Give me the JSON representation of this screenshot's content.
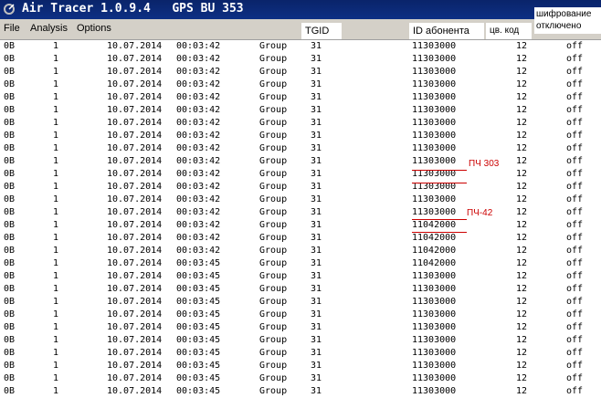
{
  "window": {
    "title": "Air Tracer 1.0.9.4   GPS BU 353"
  },
  "menu": [
    {
      "label": "File"
    },
    {
      "label": "Analysis"
    },
    {
      "label": "Options"
    }
  ],
  "headers": {
    "tgid": "TGID",
    "subscriber_id": "ID абонента",
    "color_code": "цв. код",
    "encryption_line1": "шифрование",
    "encryption_line2": "отключено"
  },
  "rows": [
    {
      "c1": "0B",
      "c2": "1",
      "date": "10.07.2014",
      "time": "00:03:42",
      "type": "Group",
      "tgid": "31",
      "subscriber": "11303000",
      "code": "12",
      "enc": "off"
    },
    {
      "c1": "0B",
      "c2": "1",
      "date": "10.07.2014",
      "time": "00:03:42",
      "type": "Group",
      "tgid": "31",
      "subscriber": "11303000",
      "code": "12",
      "enc": "off"
    },
    {
      "c1": "0B",
      "c2": "1",
      "date": "10.07.2014",
      "time": "00:03:42",
      "type": "Group",
      "tgid": "31",
      "subscriber": "11303000",
      "code": "12",
      "enc": "off"
    },
    {
      "c1": "0B",
      "c2": "1",
      "date": "10.07.2014",
      "time": "00:03:42",
      "type": "Group",
      "tgid": "31",
      "subscriber": "11303000",
      "code": "12",
      "enc": "off"
    },
    {
      "c1": "0B",
      "c2": "1",
      "date": "10.07.2014",
      "time": "00:03:42",
      "type": "Group",
      "tgid": "31",
      "subscriber": "11303000",
      "code": "12",
      "enc": "off"
    },
    {
      "c1": "0B",
      "c2": "1",
      "date": "10.07.2014",
      "time": "00:03:42",
      "type": "Group",
      "tgid": "31",
      "subscriber": "11303000",
      "code": "12",
      "enc": "off"
    },
    {
      "c1": "0B",
      "c2": "1",
      "date": "10.07.2014",
      "time": "00:03:42",
      "type": "Group",
      "tgid": "31",
      "subscriber": "11303000",
      "code": "12",
      "enc": "off"
    },
    {
      "c1": "0B",
      "c2": "1",
      "date": "10.07.2014",
      "time": "00:03:42",
      "type": "Group",
      "tgid": "31",
      "subscriber": "11303000",
      "code": "12",
      "enc": "off"
    },
    {
      "c1": "0B",
      "c2": "1",
      "date": "10.07.2014",
      "time": "00:03:42",
      "type": "Group",
      "tgid": "31",
      "subscriber": "11303000",
      "code": "12",
      "enc": "off"
    },
    {
      "c1": "0B",
      "c2": "1",
      "date": "10.07.2014",
      "time": "00:03:42",
      "type": "Group",
      "tgid": "31",
      "subscriber": "11303000",
      "code": "12",
      "enc": "off"
    },
    {
      "c1": "0B",
      "c2": "1",
      "date": "10.07.2014",
      "time": "00:03:42",
      "type": "Group",
      "tgid": "31",
      "subscriber": "11303000",
      "code": "12",
      "enc": "off"
    },
    {
      "c1": "0B",
      "c2": "1",
      "date": "10.07.2014",
      "time": "00:03:42",
      "type": "Group",
      "tgid": "31",
      "subscriber": "11303000",
      "code": "12",
      "enc": "off"
    },
    {
      "c1": "0B",
      "c2": "1",
      "date": "10.07.2014",
      "time": "00:03:42",
      "type": "Group",
      "tgid": "31",
      "subscriber": "11303000",
      "code": "12",
      "enc": "off"
    },
    {
      "c1": "0B",
      "c2": "1",
      "date": "10.07.2014",
      "time": "00:03:42",
      "type": "Group",
      "tgid": "31",
      "subscriber": "11303000",
      "code": "12",
      "enc": "off"
    },
    {
      "c1": "0B",
      "c2": "1",
      "date": "10.07.2014",
      "time": "00:03:42",
      "type": "Group",
      "tgid": "31",
      "subscriber": "11042000",
      "code": "12",
      "enc": "off"
    },
    {
      "c1": "0B",
      "c2": "1",
      "date": "10.07.2014",
      "time": "00:03:42",
      "type": "Group",
      "tgid": "31",
      "subscriber": "11042000",
      "code": "12",
      "enc": "off"
    },
    {
      "c1": "0B",
      "c2": "1",
      "date": "10.07.2014",
      "time": "00:03:42",
      "type": "Group",
      "tgid": "31",
      "subscriber": "11042000",
      "code": "12",
      "enc": "off"
    },
    {
      "c1": "0B",
      "c2": "1",
      "date": "10.07.2014",
      "time": "00:03:45",
      "type": "Group",
      "tgid": "31",
      "subscriber": "11042000",
      "code": "12",
      "enc": "off"
    },
    {
      "c1": "0B",
      "c2": "1",
      "date": "10.07.2014",
      "time": "00:03:45",
      "type": "Group",
      "tgid": "31",
      "subscriber": "11303000",
      "code": "12",
      "enc": "off"
    },
    {
      "c1": "0B",
      "c2": "1",
      "date": "10.07.2014",
      "time": "00:03:45",
      "type": "Group",
      "tgid": "31",
      "subscriber": "11303000",
      "code": "12",
      "enc": "off"
    },
    {
      "c1": "0B",
      "c2": "1",
      "date": "10.07.2014",
      "time": "00:03:45",
      "type": "Group",
      "tgid": "31",
      "subscriber": "11303000",
      "code": "12",
      "enc": "off"
    },
    {
      "c1": "0B",
      "c2": "1",
      "date": "10.07.2014",
      "time": "00:03:45",
      "type": "Group",
      "tgid": "31",
      "subscriber": "11303000",
      "code": "12",
      "enc": "off"
    },
    {
      "c1": "0B",
      "c2": "1",
      "date": "10.07.2014",
      "time": "00:03:45",
      "type": "Group",
      "tgid": "31",
      "subscriber": "11303000",
      "code": "12",
      "enc": "off"
    },
    {
      "c1": "0B",
      "c2": "1",
      "date": "10.07.2014",
      "time": "00:03:45",
      "type": "Group",
      "tgid": "31",
      "subscriber": "11303000",
      "code": "12",
      "enc": "off"
    },
    {
      "c1": "0B",
      "c2": "1",
      "date": "10.07.2014",
      "time": "00:03:45",
      "type": "Group",
      "tgid": "31",
      "subscriber": "11303000",
      "code": "12",
      "enc": "off"
    },
    {
      "c1": "0B",
      "c2": "1",
      "date": "10.07.2014",
      "time": "00:03:45",
      "type": "Group",
      "tgid": "31",
      "subscriber": "11303000",
      "code": "12",
      "enc": "off"
    },
    {
      "c1": "0B",
      "c2": "1",
      "date": "10.07.2014",
      "time": "00:03:45",
      "type": "Group",
      "tgid": "31",
      "subscriber": "11303000",
      "code": "12",
      "enc": "off"
    },
    {
      "c1": "0B",
      "c2": "1",
      "date": "10.07.2014",
      "time": "00:03:45",
      "type": "Group",
      "tgid": "31",
      "subscriber": "11303000",
      "code": "12",
      "enc": "off"
    }
  ],
  "annotations": [
    {
      "text": "ПЧ 303"
    },
    {
      "text": "ПЧ-42"
    }
  ],
  "colors": {
    "title_bg": "#0a246a",
    "menu_bg": "#d4d0c8",
    "annotation": "#cc0000"
  }
}
